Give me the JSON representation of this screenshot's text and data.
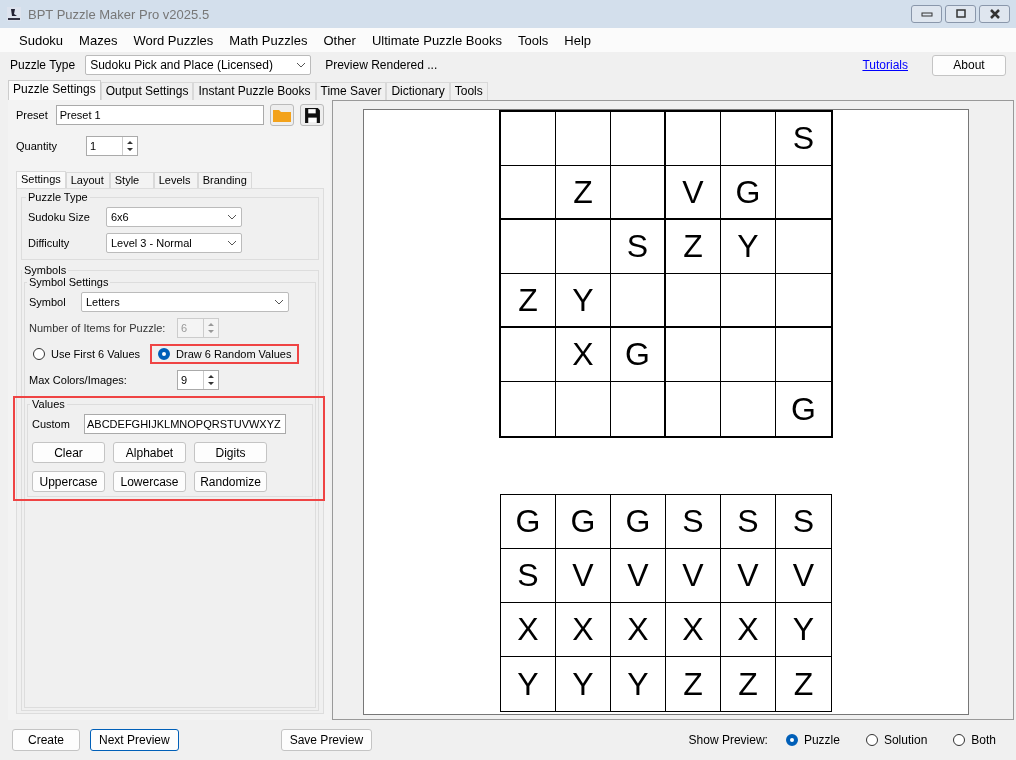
{
  "window": {
    "title": "BPT Puzzle Maker Pro v2025.5"
  },
  "menu": [
    "Sudoku",
    "Mazes",
    "Word Puzzles",
    "Math Puzzles",
    "Other",
    "Ultimate Puzzle Books",
    "Tools",
    "Help"
  ],
  "toolbar": {
    "puzzle_type_label": "Puzzle Type",
    "puzzle_type": "Sudoku Pick and Place (Licensed)",
    "status": "Preview Rendered ...",
    "tutorials_link": "Tutorials",
    "about_button": "About"
  },
  "tabs": [
    {
      "label": "Puzzle Settings",
      "selected": true
    },
    {
      "label": "Output Settings",
      "selected": false
    },
    {
      "label": "Instant Puzzle Books",
      "selected": false
    },
    {
      "label": "Time Saver",
      "selected": false
    },
    {
      "label": "Dictionary",
      "selected": false
    },
    {
      "label": "Tools",
      "selected": false
    }
  ],
  "preset": {
    "label": "Preset",
    "value": "Preset 1"
  },
  "quantity": {
    "label": "Quantity",
    "value": "1"
  },
  "subtabs": [
    {
      "label": "Settings",
      "selected": true
    },
    {
      "label": "Layout",
      "selected": false
    },
    {
      "label": "Style",
      "selected": false
    },
    {
      "label": "Levels",
      "selected": false
    },
    {
      "label": "Branding",
      "selected": false
    }
  ],
  "puzzle_type_group": {
    "title": "Puzzle Type",
    "fields": [
      {
        "label": "Sudoku Size",
        "value": "6x6"
      },
      {
        "label": "Difficulty",
        "value": "Level 3 - Normal"
      }
    ]
  },
  "symbols": {
    "title": "Symbols",
    "settings_title": "Symbol Settings",
    "symbol_label": "Symbol",
    "symbol_value": "Letters",
    "items_label": "Number of Items for Puzzle:",
    "items_value": "6",
    "items_disabled": true,
    "radios": [
      {
        "label": "Use First 6 Values",
        "selected": false,
        "highlighted": false
      },
      {
        "label": "Draw 6 Random Values",
        "selected": true,
        "highlighted": true
      }
    ],
    "max_label": "Max Colors/Images:",
    "max_value": "9"
  },
  "values": {
    "title": "Values",
    "highlighted": true,
    "custom_label": "Custom",
    "custom_value": "ABCDEFGHIJKLMNOPQRSTUVWXYZ",
    "buttons": [
      "Clear",
      "Alphabet",
      "Digits",
      "Uppercase",
      "Lowercase",
      "Randomize"
    ]
  },
  "puzzle_grid": [
    [
      {
        "kind": "blank"
      },
      {
        "kind": "blank"
      },
      {
        "kind": "blank"
      },
      {
        "kind": "blank"
      },
      {
        "kind": "blank"
      },
      {
        "kind": "given",
        "symbol": "S"
      }
    ],
    [
      {
        "kind": "blank"
      },
      {
        "kind": "given",
        "symbol": "Z"
      },
      {
        "kind": "blank"
      },
      {
        "kind": "given",
        "symbol": "V"
      },
      {
        "kind": "given",
        "symbol": "G"
      },
      {
        "kind": "blank"
      }
    ],
    [
      {
        "kind": "blank"
      },
      {
        "kind": "blank"
      },
      {
        "kind": "given",
        "symbol": "S"
      },
      {
        "kind": "given",
        "symbol": "Z"
      },
      {
        "kind": "given",
        "symbol": "Y"
      },
      {
        "kind": "blank"
      }
    ],
    [
      {
        "kind": "given",
        "symbol": "Z"
      },
      {
        "kind": "given",
        "symbol": "Y"
      },
      {
        "kind": "blank"
      },
      {
        "kind": "blank"
      },
      {
        "kind": "blank"
      },
      {
        "kind": "blank"
      }
    ],
    [
      {
        "kind": "blank"
      },
      {
        "kind": "given",
        "symbol": "X"
      },
      {
        "kind": "given",
        "symbol": "G"
      },
      {
        "kind": "blank"
      },
      {
        "kind": "blank"
      },
      {
        "kind": "blank"
      }
    ],
    [
      {
        "kind": "blank"
      },
      {
        "kind": "blank"
      },
      {
        "kind": "blank"
      },
      {
        "kind": "blank"
      },
      {
        "kind": "blank"
      },
      {
        "kind": "given",
        "symbol": "G"
      }
    ]
  ],
  "pieces_grid": [
    [
      "G",
      "G",
      "G",
      "S",
      "S",
      "S"
    ],
    [
      "S",
      "V",
      "V",
      "V",
      "V",
      "V"
    ],
    [
      "X",
      "X",
      "X",
      "X",
      "X",
      "Y"
    ],
    [
      "Y",
      "Y",
      "Y",
      "Z",
      "Z",
      "Z"
    ]
  ],
  "bottom": {
    "create": "Create",
    "next_preview": "Next Preview",
    "save_preview": "Save Preview",
    "show_label": "Show Preview:",
    "options": [
      {
        "label": "Puzzle",
        "selected": true
      },
      {
        "label": "Solution",
        "selected": false
      },
      {
        "label": "Both",
        "selected": false
      }
    ]
  }
}
